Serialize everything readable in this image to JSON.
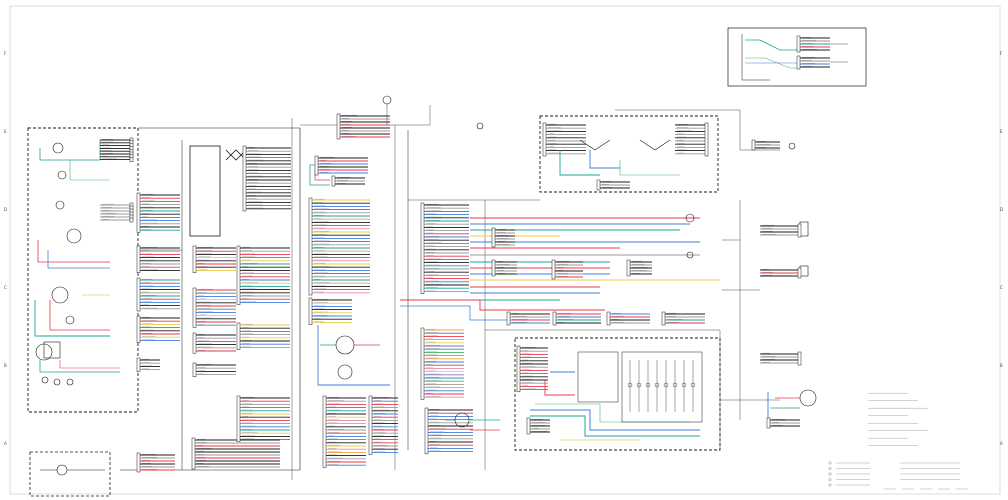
{
  "sheet": {
    "frame_rows": [
      "F",
      "E",
      "D",
      "C",
      "B",
      "A"
    ],
    "wire_colors": {
      "black": "#1c1c1c",
      "red": "#e8394a",
      "blue": "#3f7fd9",
      "teal": "#1fa59a",
      "yellow": "#e8cf4d",
      "orange": "#f0a040",
      "pink": "#e98aa8",
      "green": "#49b36b",
      "gray": "#9a9a9a",
      "purple": "#8a6fc9"
    }
  },
  "notes": {
    "heading": "NOTE",
    "items": [
      "A",
      "B",
      "C",
      "D",
      "E",
      "F",
      "G",
      "H"
    ]
  },
  "legend": {
    "heading": "SYMBOL",
    "rows": 5
  },
  "title_block": {
    "fields": 5
  }
}
